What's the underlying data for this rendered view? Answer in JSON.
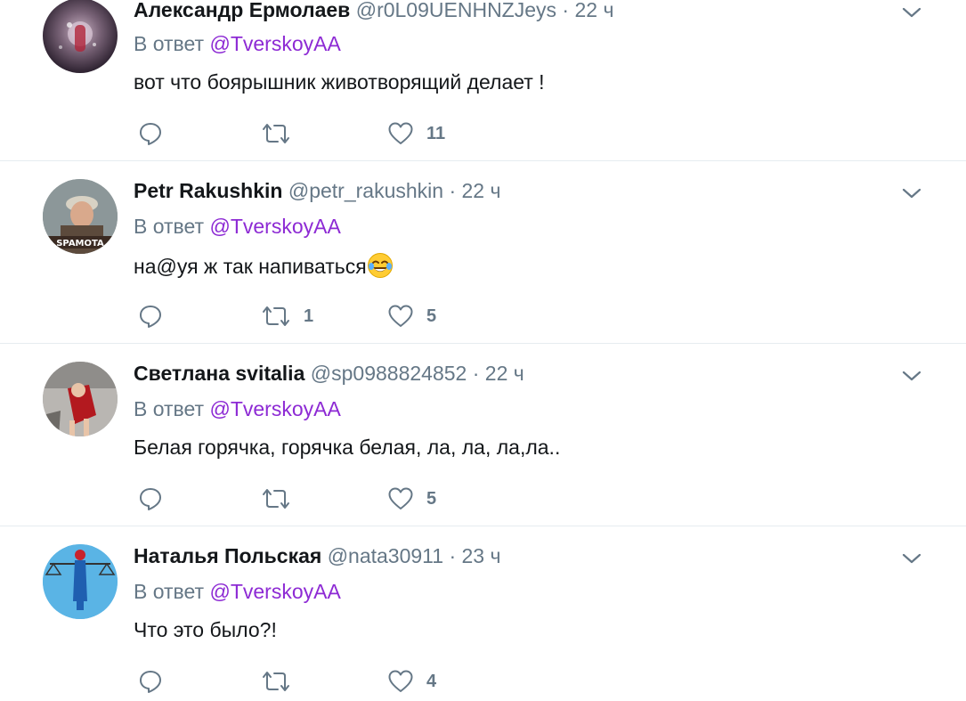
{
  "colors": {
    "accent": "#8d2ad4",
    "muted": "#657786",
    "text": "#14171a",
    "divider": "#e6ecf0"
  },
  "tweets": [
    {
      "display_name": "Александр Ермолаев",
      "handle": "@r0L09UENHNZJeys",
      "separator": "·",
      "time": "22 ч",
      "reply_prefix": "В ответ",
      "reply_to": "@TverskoyAA",
      "text": "вот что боярышник животворящий делает !",
      "retweets": "",
      "likes": "11"
    },
    {
      "display_name": "Petr Rakushkin",
      "handle": "@petr_rakushkin",
      "separator": "·",
      "time": "22 ч",
      "reply_prefix": "В ответ",
      "reply_to": "@TverskoyAA",
      "text": "на@уя ж так напиваться",
      "emoji": "face-with-tears-of-joy",
      "avatar_caption": "SPAMOTA",
      "retweets": "1",
      "likes": "5"
    },
    {
      "display_name": "Светлана svitalia",
      "handle": "@sp0988824852",
      "separator": "·",
      "time": "22 ч",
      "reply_prefix": "В ответ",
      "reply_to": "@TverskoyAA",
      "text": "Белая горячка, горячка белая, ла, ла, ла,ла..",
      "retweets": "",
      "likes": "5"
    },
    {
      "display_name": "Наталья Польская",
      "handle": "@nata30911",
      "separator": "·",
      "time": "23 ч",
      "reply_prefix": "В ответ",
      "reply_to": "@TverskoyAA",
      "text": "Что это было?!",
      "retweets": "",
      "likes": "4"
    }
  ]
}
